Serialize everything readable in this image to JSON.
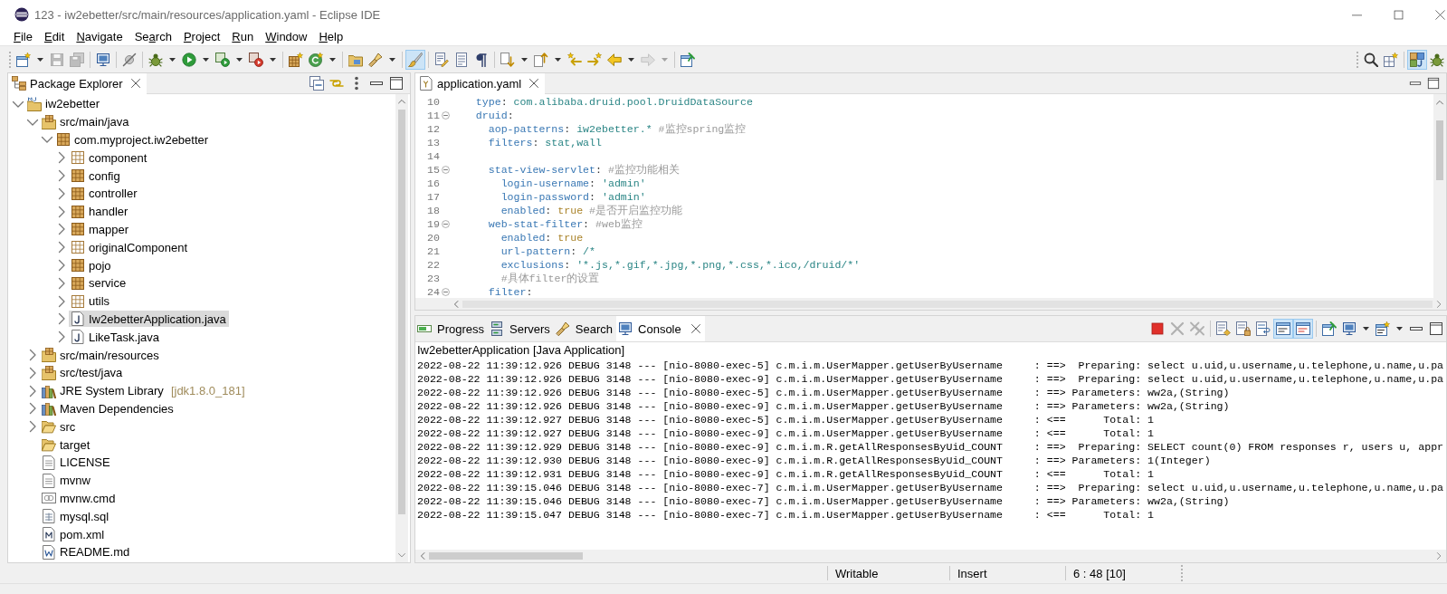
{
  "window": {
    "title": "123 - iw2ebetter/src/main/resources/application.yaml - Eclipse IDE"
  },
  "menu": [
    {
      "key": "F",
      "after": "ile"
    },
    {
      "key": "E",
      "after": "dit"
    },
    {
      "key": "N",
      "after": "avigate"
    },
    {
      "before": "Se",
      "key": "a",
      "after": "rch"
    },
    {
      "key": "P",
      "after": "roject"
    },
    {
      "key": "R",
      "after": "un"
    },
    {
      "key": "W",
      "after": "indow"
    },
    {
      "key": "H",
      "after": "elp"
    }
  ],
  "toolbar": {
    "left": [
      {
        "disabled": false,
        "on": false
      },
      {
        "disabled": true,
        "on": false
      },
      {
        "disabled": true,
        "on": false
      },
      {
        "disabled": false,
        "on": false
      },
      {
        "disabled": false,
        "on": false
      },
      {
        "disabled": false,
        "on": false
      },
      {
        "disabled": false,
        "on": false
      },
      {
        "disabled": false,
        "on": false
      },
      {
        "disabled": false,
        "on": false
      },
      {
        "disabled": false,
        "on": false
      },
      {
        "disabled": false,
        "on": false
      },
      {
        "disabled": false,
        "on": false
      },
      {
        "disabled": false,
        "on": false
      },
      {
        "disabled": false,
        "on": true
      },
      {
        "disabled": false,
        "on": false
      },
      {
        "disabled": false,
        "on": false
      },
      {
        "disabled": false,
        "on": false
      },
      {
        "disabled": false,
        "on": false
      },
      {
        "disabled": false,
        "on": false
      },
      {
        "disabled": false,
        "on": false
      },
      {
        "disabled": false,
        "on": false
      },
      {
        "disabled": false,
        "on": false
      },
      {
        "disabled": true,
        "on": false
      },
      {
        "disabled": false,
        "on": false
      }
    ],
    "right": [
      {
        "disabled": false,
        "on": false
      },
      {
        "disabled": false,
        "on": false
      },
      {
        "disabled": false,
        "on": true
      },
      {
        "disabled": false,
        "on": false
      }
    ]
  },
  "package_explorer": {
    "tabs": [
      {
        "label": "Package Explorer",
        "selected": true
      }
    ],
    "tree": [
      {
        "label": "iw2ebetter",
        "kind": "project",
        "expanded": true,
        "selected": false,
        "children": [
          {
            "label": "src/main/java",
            "kind": "source",
            "expanded": true,
            "selected": false,
            "children": [
              {
                "label": "com.myproject.iw2ebetter",
                "kind": "package",
                "expanded": true,
                "selected": false,
                "children": [
                  {
                    "label": "component",
                    "kind": "empty-package",
                    "expanded": false,
                    "selected": false
                  },
                  {
                    "label": "config",
                    "kind": "package",
                    "expanded": false,
                    "selected": false
                  },
                  {
                    "label": "controller",
                    "kind": "package",
                    "expanded": false,
                    "selected": false
                  },
                  {
                    "label": "handler",
                    "kind": "package",
                    "expanded": false,
                    "selected": false
                  },
                  {
                    "label": "mapper",
                    "kind": "package",
                    "expanded": false,
                    "selected": false
                  },
                  {
                    "label": "originalComponent",
                    "kind": "empty-package",
                    "expanded": false,
                    "selected": false
                  },
                  {
                    "label": "pojo",
                    "kind": "package",
                    "expanded": false,
                    "selected": false
                  },
                  {
                    "label": "service",
                    "kind": "package",
                    "expanded": false,
                    "selected": false
                  },
                  {
                    "label": "utils",
                    "kind": "empty-package",
                    "expanded": false,
                    "selected": false
                  },
                  {
                    "label": "Iw2ebetterApplication.java",
                    "kind": "java",
                    "expanded": false,
                    "selected": true
                  },
                  {
                    "label": "LikeTask.java",
                    "kind": "java",
                    "expanded": false,
                    "selected": false
                  }
                ]
              }
            ]
          },
          {
            "label": "src/main/resources",
            "kind": "source",
            "expanded": false,
            "selected": false
          },
          {
            "label": "src/test/java",
            "kind": "source",
            "expanded": false,
            "selected": false
          },
          {
            "label": "JRE System Library",
            "decoration": "[jdk1.8.0_181]",
            "kind": "library",
            "expanded": false,
            "selected": false
          },
          {
            "label": "Maven Dependencies",
            "kind": "library",
            "expanded": false,
            "selected": false
          },
          {
            "label": "src",
            "kind": "folder",
            "expanded": false,
            "selected": false
          },
          {
            "label": "target",
            "kind": "folder",
            "selected": false
          },
          {
            "label": "LICENSE",
            "kind": "text",
            "selected": false
          },
          {
            "label": "mvnw",
            "kind": "text",
            "selected": false
          },
          {
            "label": "mvnw.cmd",
            "kind": "script",
            "selected": false
          },
          {
            "label": "mysql.sql",
            "kind": "sql",
            "selected": false
          },
          {
            "label": "pom.xml",
            "kind": "xml",
            "selected": false
          },
          {
            "label": "README.md",
            "kind": "markdown",
            "selected": false
          }
        ]
      }
    ]
  },
  "editor": {
    "tabs": [
      {
        "label": "application.yaml",
        "selected": true
      }
    ],
    "lines": [
      {
        "number": "10",
        "tokens": [
          {
            "kind": "key",
            "text": "type"
          },
          {
            "kind": "punct",
            "text": ": "
          },
          {
            "kind": "value",
            "text": "com.alibaba.druid.pool.DruidDataSource"
          }
        ]
      },
      {
        "number": "11",
        "expanded": true,
        "tokens": [
          {
            "kind": "key",
            "text": "druid"
          },
          {
            "kind": "punct",
            "text": ":"
          }
        ],
        "children": [
          {
            "number": "12",
            "tokens": [
              {
                "kind": "key",
                "text": "aop-patterns"
              },
              {
                "kind": "punct",
                "text": ": "
              },
              {
                "kind": "value",
                "text": "iw2ebetter.* "
              },
              {
                "kind": "comment",
                "text": "#监控spring监控"
              }
            ]
          },
          {
            "number": "13",
            "tokens": [
              {
                "kind": "key",
                "text": "filters"
              },
              {
                "kind": "punct",
                "text": ": "
              },
              {
                "kind": "value",
                "text": "stat,wall"
              }
            ]
          },
          {
            "number": "14"
          },
          {
            "number": "15",
            "expanded": true,
            "tokens": [
              {
                "kind": "key",
                "text": "stat-view-servlet"
              },
              {
                "kind": "punct",
                "text": ": "
              },
              {
                "kind": "comment",
                "text": "#监控功能相关"
              }
            ],
            "children": [
              {
                "number": "16",
                "tokens": [
                  {
                    "kind": "key",
                    "text": "login-username"
                  },
                  {
                    "kind": "punct",
                    "text": ": "
                  },
                  {
                    "kind": "value",
                    "text": "'admin'"
                  }
                ]
              },
              {
                "number": "17",
                "tokens": [
                  {
                    "kind": "key",
                    "text": "login-password"
                  },
                  {
                    "kind": "punct",
                    "text": ": "
                  },
                  {
                    "kind": "value",
                    "text": "'admin'"
                  }
                ]
              },
              {
                "number": "18",
                "tokens": [
                  {
                    "kind": "key",
                    "text": "enabled"
                  },
                  {
                    "kind": "punct",
                    "text": ": "
                  },
                  {
                    "kind": "bool",
                    "text": "true "
                  },
                  {
                    "kind": "comment",
                    "text": "#是否开启监控功能"
                  }
                ]
              }
            ]
          },
          {
            "number": "19",
            "expanded": true,
            "tokens": [
              {
                "kind": "key",
                "text": "web-stat-filter"
              },
              {
                "kind": "punct",
                "text": ": "
              },
              {
                "kind": "comment",
                "text": "#web监控"
              }
            ],
            "children": [
              {
                "number": "20",
                "tokens": [
                  {
                    "kind": "key",
                    "text": "enabled"
                  },
                  {
                    "kind": "punct",
                    "text": ": "
                  },
                  {
                    "kind": "bool",
                    "text": "true"
                  }
                ]
              },
              {
                "number": "21",
                "tokens": [
                  {
                    "kind": "key",
                    "text": "url-pattern"
                  },
                  {
                    "kind": "punct",
                    "text": ": "
                  },
                  {
                    "kind": "value",
                    "text": "/*"
                  }
                ]
              },
              {
                "number": "22",
                "tokens": [
                  {
                    "kind": "key",
                    "text": "exclusions"
                  },
                  {
                    "kind": "punct",
                    "text": ": "
                  },
                  {
                    "kind": "value",
                    "text": "'*.js,*.gif,*.jpg,*.png,*.css,*.ico,/druid/*'"
                  }
                ]
              },
              {
                "number": "23",
                "tokens": [
                  {
                    "kind": "comment",
                    "text": "#具体filter的设置"
                  }
                ]
              }
            ]
          },
          {
            "number": "24",
            "expanded": true,
            "tokens": [
              {
                "kind": "key",
                "text": "filter"
              },
              {
                "kind": "punct",
                "text": ":"
              }
            ]
          }
        ]
      }
    ]
  },
  "console": {
    "tabs": [
      {
        "label": "Progress",
        "selected": false
      },
      {
        "label": "Servers",
        "selected": false
      },
      {
        "label": "Search",
        "selected": false
      },
      {
        "label": "Console",
        "selected": true
      }
    ],
    "toolbar": [
      {
        "disabled": false,
        "on": false
      },
      {
        "disabled": true,
        "on": false
      },
      {
        "disabled": true,
        "on": false
      },
      {
        "disabled": false,
        "on": false
      },
      {
        "disabled": false,
        "on": false
      },
      {
        "disabled": false,
        "on": false
      },
      {
        "disabled": false,
        "on": true
      },
      {
        "disabled": false,
        "on": true
      },
      {
        "disabled": false,
        "on": false
      },
      {
        "disabled": false,
        "on": false
      },
      {
        "disabled": false,
        "on": false
      },
      {
        "disabled": false,
        "on": false
      },
      {
        "disabled": false,
        "on": false
      }
    ],
    "process": "Iw2ebetterApplication [Java Application]",
    "lines": [
      "2022-08-22 11:39:12.926 DEBUG 3148 --- [nio-8080-exec-5] c.m.i.m.UserMapper.getUserByUsername     : ==>  Preparing: select u.uid,u.username,u.telephone,u.name,u.pa",
      "2022-08-22 11:39:12.926 DEBUG 3148 --- [nio-8080-exec-9] c.m.i.m.UserMapper.getUserByUsername     : ==>  Preparing: select u.uid,u.username,u.telephone,u.name,u.pa",
      "2022-08-22 11:39:12.926 DEBUG 3148 --- [nio-8080-exec-5] c.m.i.m.UserMapper.getUserByUsername     : ==> Parameters: ww2a,(String)",
      "2022-08-22 11:39:12.926 DEBUG 3148 --- [nio-8080-exec-9] c.m.i.m.UserMapper.getUserByUsername     : ==> Parameters: ww2a,(String)",
      "2022-08-22 11:39:12.927 DEBUG 3148 --- [nio-8080-exec-5] c.m.i.m.UserMapper.getUserByUsername     : <==      Total: 1",
      "2022-08-22 11:39:12.927 DEBUG 3148 --- [nio-8080-exec-9] c.m.i.m.UserMapper.getUserByUsername     : <==      Total: 1",
      "2022-08-22 11:39:12.929 DEBUG 3148 --- [nio-8080-exec-9] c.m.i.m.R.getAllResponsesByUid_COUNT     : ==>  Preparing: SELECT count(0) FROM responses r, users u, appr",
      "2022-08-22 11:39:12.930 DEBUG 3148 --- [nio-8080-exec-9] c.m.i.m.R.getAllResponsesByUid_COUNT     : ==> Parameters: 1(Integer)",
      "2022-08-22 11:39:12.931 DEBUG 3148 --- [nio-8080-exec-9] c.m.i.m.R.getAllResponsesByUid_COUNT     : <==      Total: 1",
      "2022-08-22 11:39:15.046 DEBUG 3148 --- [nio-8080-exec-7] c.m.i.m.UserMapper.getUserByUsername     : ==>  Preparing: select u.uid,u.username,u.telephone,u.name,u.pa",
      "2022-08-22 11:39:15.046 DEBUG 3148 --- [nio-8080-exec-7] c.m.i.m.UserMapper.getUserByUsername     : ==> Parameters: ww2a,(String)",
      "2022-08-22 11:39:15.047 DEBUG 3148 --- [nio-8080-exec-7] c.m.i.m.UserMapper.getUserByUsername     : <==      Total: 1"
    ]
  },
  "status_bar": [
    "Writable",
    "Insert",
    "6 : 48 [10]"
  ]
}
